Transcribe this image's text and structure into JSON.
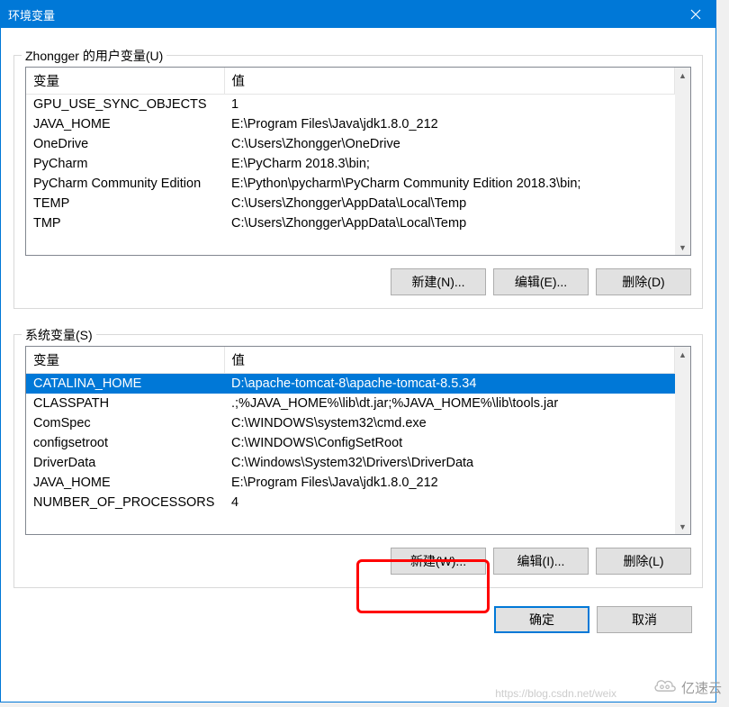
{
  "window": {
    "title": "环境变量"
  },
  "userVars": {
    "label": "Zhongger 的用户变量(U)",
    "header_var": "变量",
    "header_val": "值",
    "rows": [
      {
        "name": "GPU_USE_SYNC_OBJECTS",
        "value": "1"
      },
      {
        "name": "JAVA_HOME",
        "value": "E:\\Program Files\\Java\\jdk1.8.0_212"
      },
      {
        "name": "OneDrive",
        "value": "C:\\Users\\Zhongger\\OneDrive"
      },
      {
        "name": "PyCharm",
        "value": "E:\\PyCharm 2018.3\\bin;"
      },
      {
        "name": "PyCharm Community Edition",
        "value": "E:\\Python\\pycharm\\PyCharm Community Edition 2018.3\\bin;"
      },
      {
        "name": "TEMP",
        "value": "C:\\Users\\Zhongger\\AppData\\Local\\Temp"
      },
      {
        "name": "TMP",
        "value": "C:\\Users\\Zhongger\\AppData\\Local\\Temp"
      }
    ],
    "buttons": {
      "new": "新建(N)...",
      "edit": "编辑(E)...",
      "delete": "删除(D)"
    }
  },
  "sysVars": {
    "label": "系统变量(S)",
    "header_var": "变量",
    "header_val": "值",
    "rows": [
      {
        "name": "CATALINA_HOME",
        "value": "D:\\apache-tomcat-8\\apache-tomcat-8.5.34",
        "selected": true
      },
      {
        "name": "CLASSPATH",
        "value": ".;%JAVA_HOME%\\lib\\dt.jar;%JAVA_HOME%\\lib\\tools.jar"
      },
      {
        "name": "ComSpec",
        "value": "C:\\WINDOWS\\system32\\cmd.exe"
      },
      {
        "name": "configsetroot",
        "value": "C:\\WINDOWS\\ConfigSetRoot"
      },
      {
        "name": "DriverData",
        "value": "C:\\Windows\\System32\\Drivers\\DriverData"
      },
      {
        "name": "JAVA_HOME",
        "value": "E:\\Program Files\\Java\\jdk1.8.0_212"
      },
      {
        "name": "NUMBER_OF_PROCESSORS",
        "value": "4"
      }
    ],
    "buttons": {
      "new": "新建(W)...",
      "edit": "编辑(I)...",
      "delete": "删除(L)"
    }
  },
  "footer": {
    "ok": "确定",
    "cancel": "取消"
  },
  "watermark": "https://blog.csdn.net/weix",
  "logo_text": "亿速云"
}
